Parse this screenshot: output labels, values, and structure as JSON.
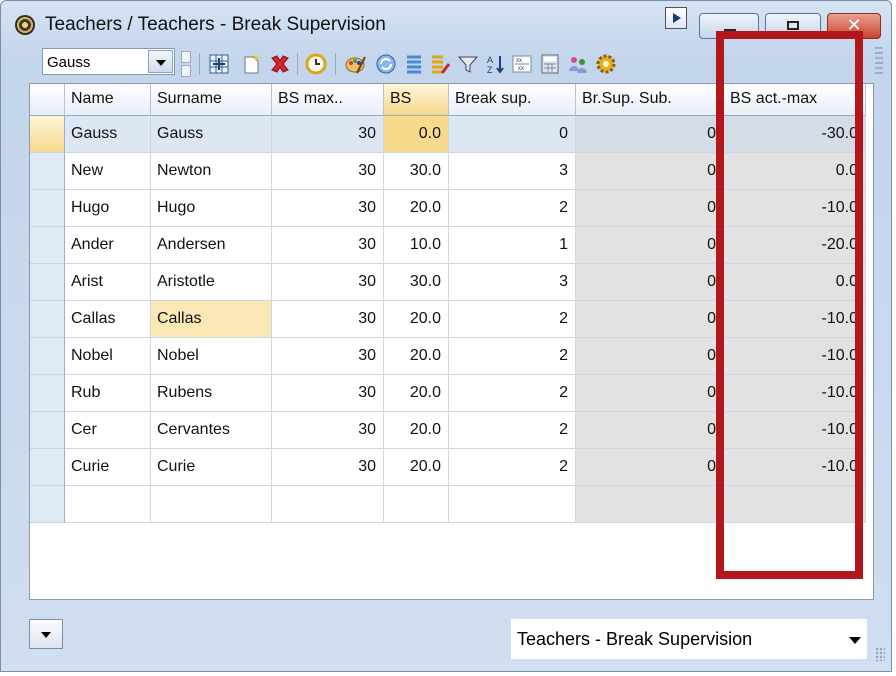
{
  "window": {
    "title": "Teachers / Teachers - Break Supervision"
  },
  "toolbar": {
    "teacher_select_value": "Gauss",
    "icons": [
      "grid-properties-icon",
      "new-record-icon",
      "delete-icon",
      "clock-icon",
      "palette-icon",
      "refresh-icon",
      "list-icon",
      "edit-list-icon",
      "filter-icon",
      "sort-icon",
      "formula-icon",
      "group-icon",
      "settings-gear-icon"
    ]
  },
  "grid": {
    "columns": [
      "Name",
      "Surname",
      "BS max..",
      "BS",
      "Break sup.",
      "Br.Sup. Sub.",
      "BS act.-max"
    ],
    "rows": [
      [
        "Gauss",
        "Gauss",
        "30",
        "0.0",
        "0",
        "0",
        "-30.0"
      ],
      [
        "New",
        "Newton",
        "30",
        "30.0",
        "3",
        "0",
        "0.0"
      ],
      [
        "Hugo",
        "Hugo",
        "30",
        "20.0",
        "2",
        "0",
        "-10.0"
      ],
      [
        "Ander",
        "Andersen",
        "30",
        "10.0",
        "1",
        "0",
        "-20.0"
      ],
      [
        "Arist",
        "Aristotle",
        "30",
        "30.0",
        "3",
        "0",
        "0.0"
      ],
      [
        "Callas",
        "Callas",
        "30",
        "20.0",
        "2",
        "0",
        "-10.0"
      ],
      [
        "Nobel",
        "Nobel",
        "30",
        "20.0",
        "2",
        "0",
        "-10.0"
      ],
      [
        "Rub",
        "Rubens",
        "30",
        "20.0",
        "2",
        "0",
        "-10.0"
      ],
      [
        "Cer",
        "Cervantes",
        "30",
        "20.0",
        "2",
        "0",
        "-10.0"
      ],
      [
        "Curie",
        "Curie",
        "30",
        "20.0",
        "2",
        "0",
        "-10.0"
      ]
    ]
  },
  "footer": {
    "view_select_value": "Teachers - Break Supervision"
  },
  "colors": {
    "highlight_box": "#b3161b",
    "selected_cell": "#f7da8c",
    "gray_column": "#e2e2e2"
  }
}
